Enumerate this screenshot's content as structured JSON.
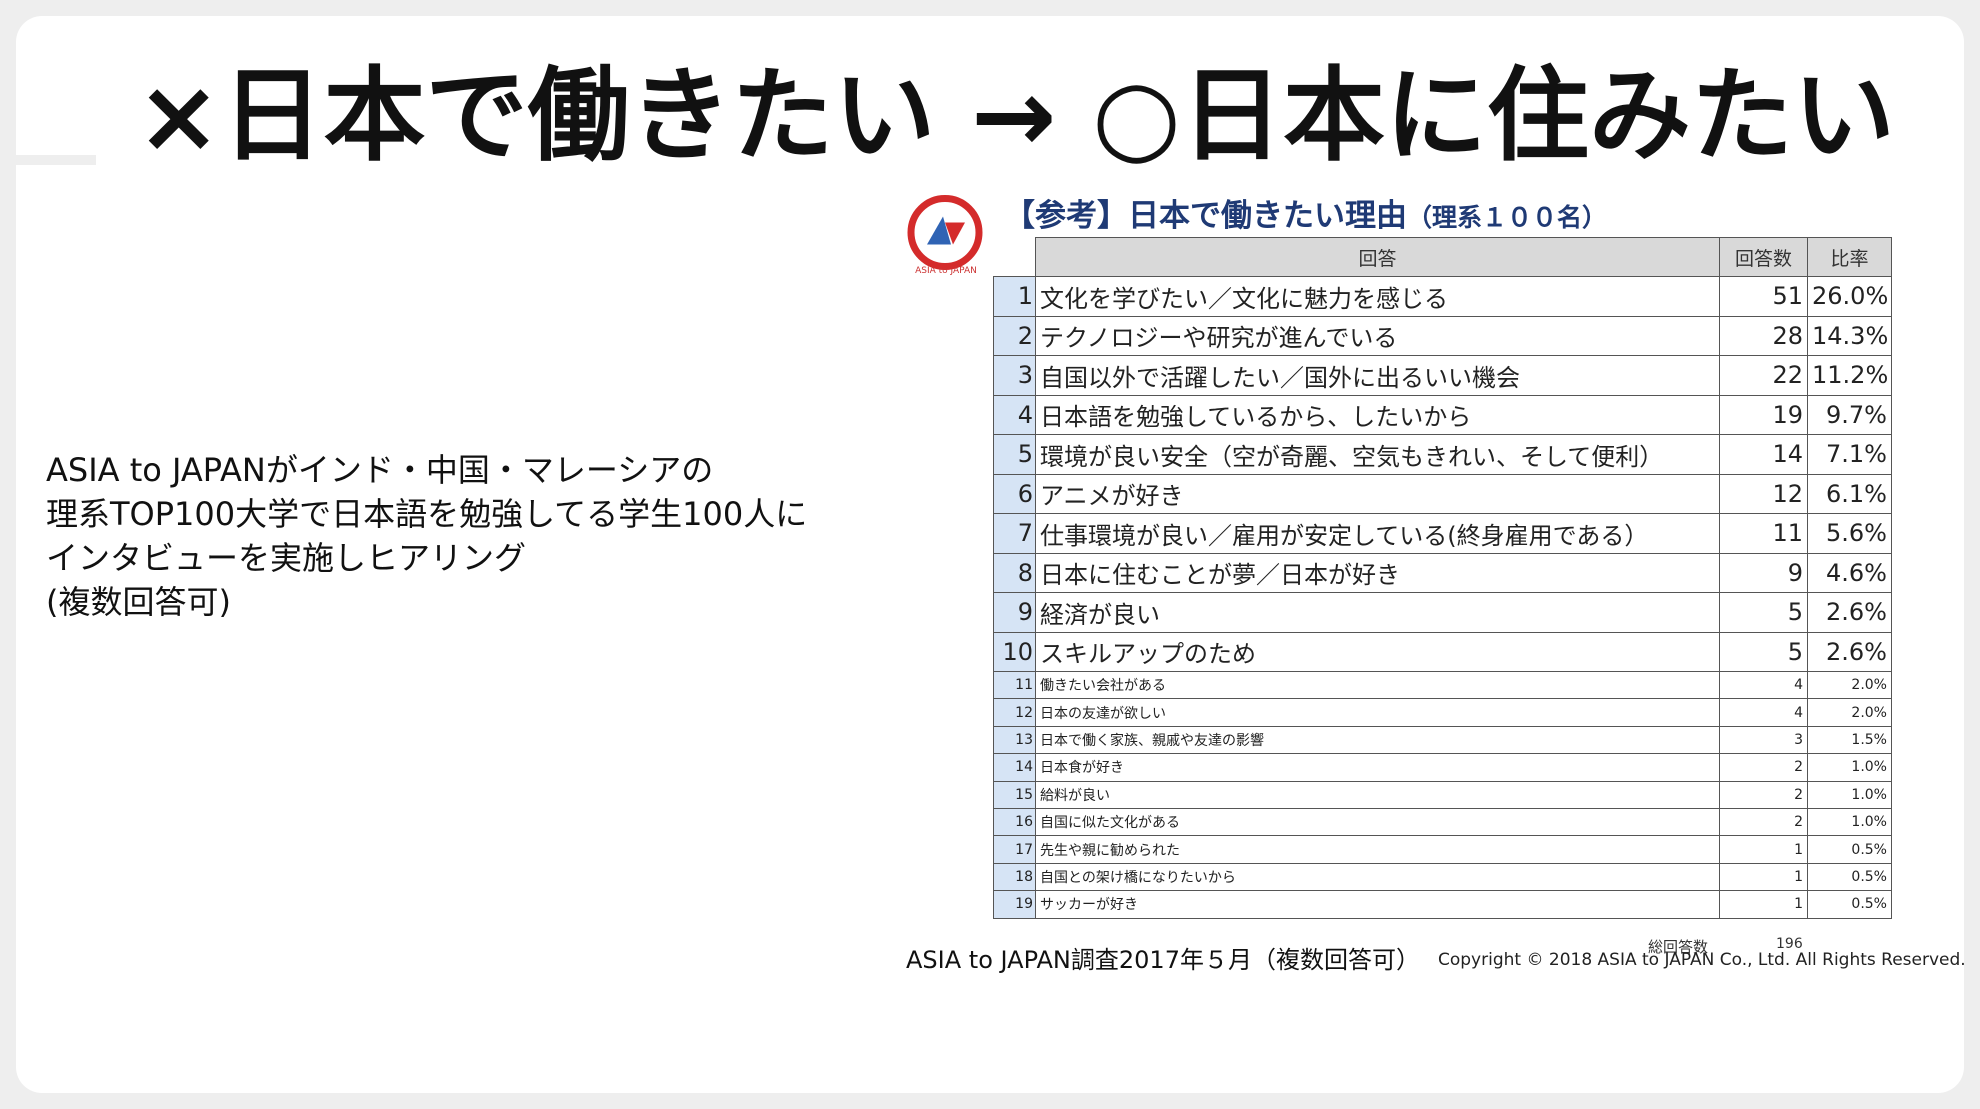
{
  "title": "×日本で働きたい → ○日本に住みたい",
  "description": [
    "ASIA to JAPANがインド・中国・マレーシアの",
    "理系TOP100大学で日本語を勉強してる学生100人に",
    "インタビューを実施しヒアリング",
    "(複数回答可)"
  ],
  "logo": {
    "text": "ASIA to JAPAN",
    "colors": {
      "ring": "#d42b2b",
      "blue": "#2f63b4",
      "red": "#d42b2b"
    }
  },
  "chart_title": {
    "main": "【参考】日本で働きたい理由",
    "sub": "（理系１００名）"
  },
  "table": {
    "headers": {
      "answer": "回答",
      "count": "回答数",
      "ratio": "比率"
    },
    "rows": [
      {
        "rank": "1",
        "answer": "文化を学びたい／文化に魅力を感じる",
        "count": "51",
        "ratio": "26.0%"
      },
      {
        "rank": "2",
        "answer": "テクノロジーや研究が進んでいる",
        "count": "28",
        "ratio": "14.3%"
      },
      {
        "rank": "3",
        "answer": "自国以外で活躍したい／国外に出るいい機会",
        "count": "22",
        "ratio": "11.2%"
      },
      {
        "rank": "4",
        "answer": "日本語を勉強しているから、したいから",
        "count": "19",
        "ratio": "9.7%"
      },
      {
        "rank": "5",
        "answer": "環境が良い安全（空が奇麗、空気もきれい、そして便利）",
        "count": "14",
        "ratio": "7.1%"
      },
      {
        "rank": "6",
        "answer": "アニメが好き",
        "count": "12",
        "ratio": "6.1%"
      },
      {
        "rank": "7",
        "answer": "仕事環境が良い／雇用が安定している(終身雇用である）",
        "count": "11",
        "ratio": "5.6%"
      },
      {
        "rank": "8",
        "answer": "日本に住むことが夢／日本が好き",
        "count": "9",
        "ratio": "4.6%"
      },
      {
        "rank": "9",
        "answer": "経済が良い",
        "count": "5",
        "ratio": "2.6%"
      },
      {
        "rank": "10",
        "answer": "スキルアップのため",
        "count": "5",
        "ratio": "2.6%"
      },
      {
        "rank": "11",
        "answer": "働きたい会社がある",
        "count": "4",
        "ratio": "2.0%"
      },
      {
        "rank": "12",
        "answer": "日本の友達が欲しい",
        "count": "4",
        "ratio": "2.0%"
      },
      {
        "rank": "13",
        "answer": "日本で働く家族、親戚や友達の影響",
        "count": "3",
        "ratio": "1.5%"
      },
      {
        "rank": "14",
        "answer": "日本食が好き",
        "count": "2",
        "ratio": "1.0%"
      },
      {
        "rank": "15",
        "answer": "給料が良い",
        "count": "2",
        "ratio": "1.0%"
      },
      {
        "rank": "16",
        "answer": "自国に似た文化がある",
        "count": "2",
        "ratio": "1.0%"
      },
      {
        "rank": "17",
        "answer": "先生や親に勧められた",
        "count": "1",
        "ratio": "0.5%"
      },
      {
        "rank": "18",
        "answer": "自国との架け橋になりたいから",
        "count": "1",
        "ratio": "0.5%"
      },
      {
        "rank": "19",
        "answer": "サッカーが好き",
        "count": "1",
        "ratio": "0.5%"
      }
    ],
    "total_label": "総回答数",
    "total_value": "196"
  },
  "source": "ASIA to JAPAN調査2017年５月（複数回答可）",
  "copyright": "Copyright © 2018 ASIA to JAPAN Co., Ltd.  All Rights Reserved."
}
